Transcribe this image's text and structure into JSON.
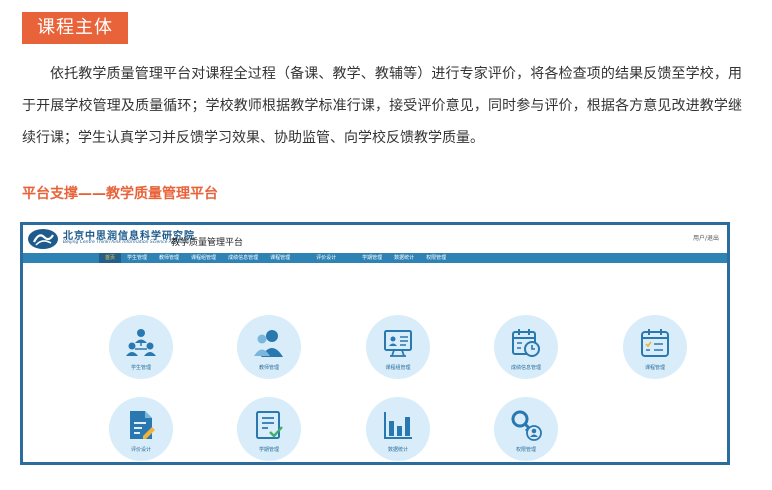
{
  "section": {
    "title": "课程主体"
  },
  "intro": {
    "paragraph": "依托教学质量管理平台对课程全过程（备课、教学、教辅等）进行专家评价，将各检查项的结果反馈至学校，用于开展学校管理及质量循环；学校教师根据教学标准行课，接受评价意见，同时参与评价，根据各方意见改进教学继续行课；学生认真学习并反馈学习效果、协助监管、向学校反馈教学质量。"
  },
  "subheading": "平台支撑——教学质量管理平台",
  "app": {
    "institution_cn": "北京中思润信息科学研究院",
    "institution_en": "Beijing Centre ThinkThink Information Science Academy",
    "title": "教学质量管理平台",
    "user_label": "用户/退出",
    "nav": [
      {
        "label": "首页",
        "active": true
      },
      {
        "label": "学生管理"
      },
      {
        "label": "教师管理"
      },
      {
        "label": "课程组管理"
      },
      {
        "label": "成绩信息管理"
      },
      {
        "label": "课程管理"
      },
      {
        "label": "评价设计"
      },
      {
        "label": "学期管理"
      },
      {
        "label": "数据统计"
      },
      {
        "label": "权限管理"
      }
    ],
    "tiles": [
      {
        "label": "学生管理",
        "icon": "students-icon"
      },
      {
        "label": "教师管理",
        "icon": "teacher-icon"
      },
      {
        "label": "课程组管理",
        "icon": "presentation-icon"
      },
      {
        "label": "成绩信息管理",
        "icon": "calendar-clock-icon"
      },
      {
        "label": "课程管理",
        "icon": "calendar-check-icon"
      },
      {
        "label": "评价设计",
        "icon": "document-edit-icon"
      },
      {
        "label": "学期管理",
        "icon": "clipboard-check-icon"
      },
      {
        "label": "数据统计",
        "icon": "bar-chart-icon"
      },
      {
        "label": "权限管理",
        "icon": "key-user-icon"
      }
    ],
    "colors": {
      "nav": "#2e82b4",
      "frame": "#2a6d9c",
      "tile_bg": "#d8edf9",
      "icon": "#2a78b0",
      "accent": "#e8633a"
    }
  }
}
